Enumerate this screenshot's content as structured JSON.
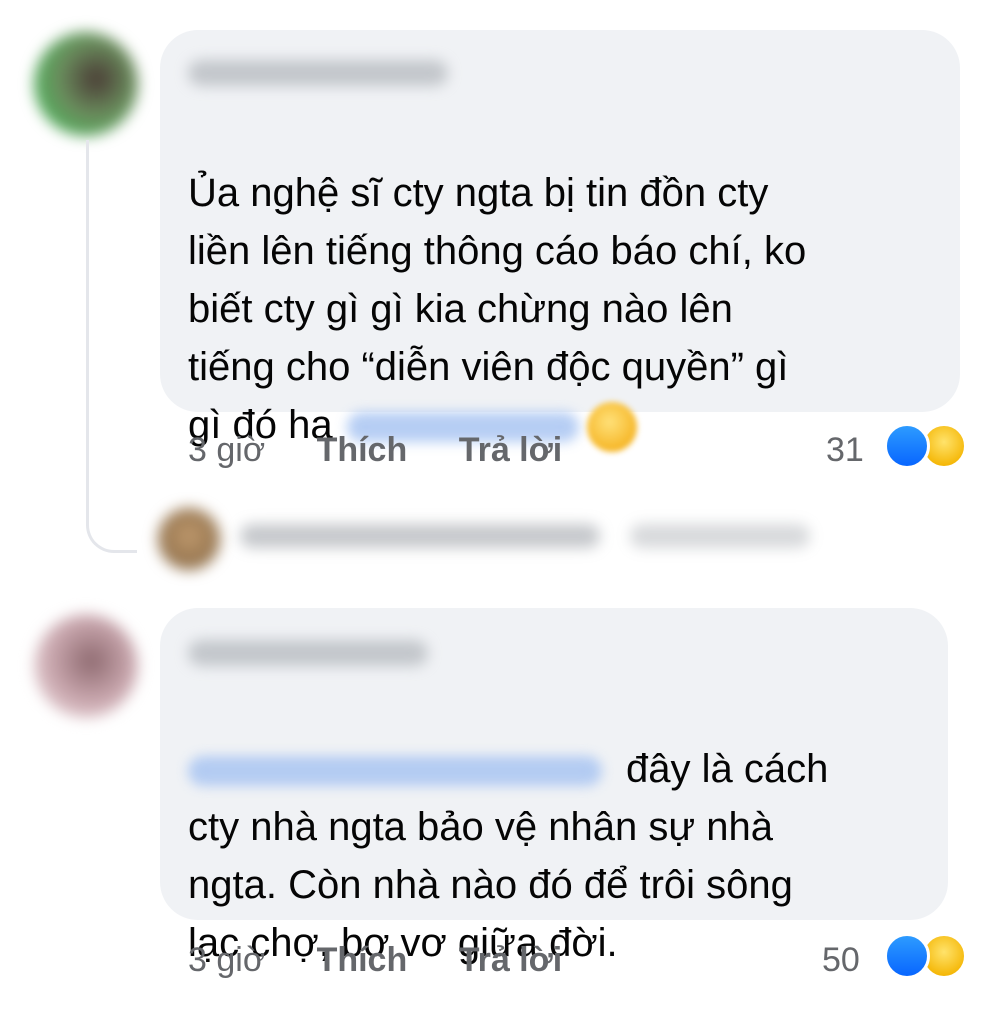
{
  "comments": [
    {
      "text": "Ủa nghệ sĩ cty ngta bị tin đồn cty\nliền lên tiếng thông cáo báo chí, ko\nbiết cty gì gì kia chừng nào lên\ntiếng cho “diễn viên độc quyền” gì\ngì đó ha",
      "time": "3 giờ",
      "like_label": "Thích",
      "reply_label": "Trả lời",
      "reaction_count": "31"
    },
    {
      "text_first": "đây là cách",
      "text_rest": "cty nhà ngta bảo vệ nhân sự nhà\nngta. Còn nhà nào đó để trôi sông\nlạc chợ, bơ vơ giữa đời.",
      "time": "3 giờ",
      "like_label": "Thích",
      "reply_label": "Trả lời",
      "reaction_count": "50"
    }
  ],
  "icons": {
    "like": "like-reaction-icon",
    "haha": "haha-reaction-icon",
    "emoji": "grinning-emoji-icon"
  },
  "colors": {
    "bubble": "#f0f2f5",
    "meta_text": "#65676b",
    "like_blue": "#0866ff",
    "haha_yellow": "#f7b928"
  }
}
